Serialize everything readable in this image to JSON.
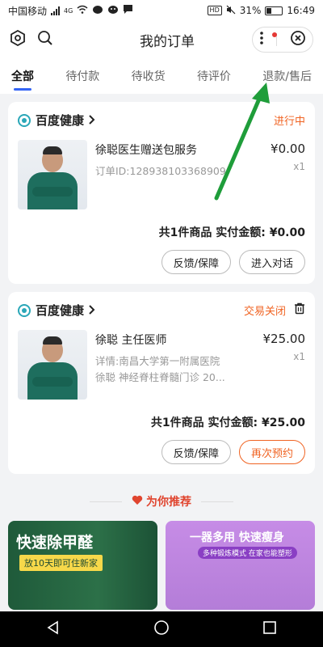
{
  "status_bar": {
    "carrier": "中国移动",
    "network": "4G",
    "hd": "HD",
    "battery": "31%",
    "time": "16:49"
  },
  "header": {
    "title": "我的订单"
  },
  "tabs": [
    "全部",
    "待付款",
    "待收货",
    "待评价",
    "退款/售后"
  ],
  "orders": [
    {
      "store": "百度健康",
      "status": "进行中",
      "title": "徐聪医生赠送包服务",
      "sub": "订单ID:128938103368909",
      "price": "¥0.00",
      "qty": "x1",
      "summary_prefix": "共1件商品 实付金额:",
      "total": "¥0.00",
      "buttons": [
        "反馈/保障",
        "进入对话"
      ]
    },
    {
      "store": "百度健康",
      "status": "交易关闭",
      "title": "徐聪 主任医师",
      "sub": "详情:南昌大学第一附属医院",
      "sub2": "徐聪 神经脊柱脊髓门诊 20...",
      "price": "¥25.00",
      "qty": "x1",
      "summary_prefix": "共1件商品 实付金额:",
      "total": "¥25.00",
      "buttons": [
        "反馈/保障",
        "再次预约"
      ]
    }
  ],
  "recommend": {
    "label": "为你推荐"
  },
  "banners": [
    {
      "title": "快速除甲醛",
      "subtitle": "放10天即可住新家"
    },
    {
      "title": "一器多用 快速瘦身",
      "subtitle": "多种锻炼模式 在家也能塑形"
    }
  ],
  "colors": {
    "accent": "#f06322",
    "tab_indicator": "#3364f5",
    "arrow": "#1f9d3a"
  }
}
